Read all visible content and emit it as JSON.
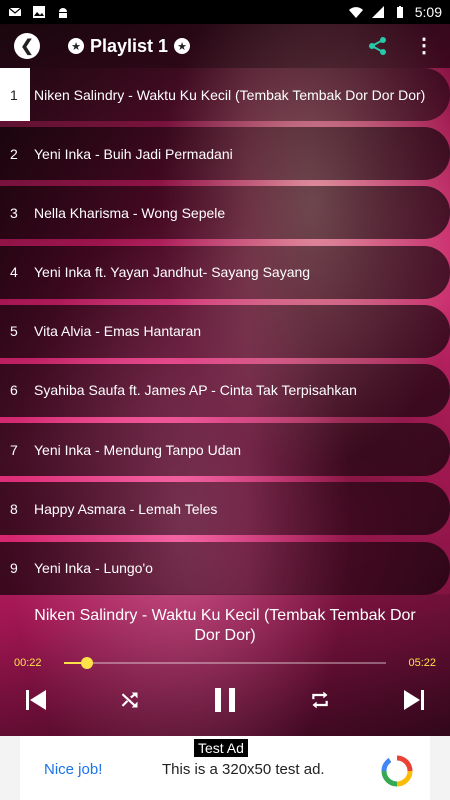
{
  "status_bar": {
    "time": "5:09",
    "left_icons": [
      "mail-icon",
      "image-icon",
      "android-icon"
    ],
    "right_icons": [
      "wifi-icon",
      "signal-icon",
      "battery-icon"
    ]
  },
  "appbar": {
    "title": "Playlist 1",
    "back_icon": "back-arrow-icon",
    "share_icon": "share-icon",
    "more_icon": "more-vertical-icon"
  },
  "playlist": {
    "active_index": 0,
    "tracks": [
      {
        "num": "1",
        "title": "Niken Salindry - Waktu Ku Kecil (Tembak Tembak Dor Dor Dor)"
      },
      {
        "num": "2",
        "title": "Yeni Inka - Buih Jadi Permadani"
      },
      {
        "num": "3",
        "title": "Nella Kharisma - Wong Sepele"
      },
      {
        "num": "4",
        "title": "Yeni Inka  ft. Yayan Jandhut- Sayang Sayang"
      },
      {
        "num": "5",
        "title": "Vita Alvia - Emas Hantaran"
      },
      {
        "num": "6",
        "title": "Syahiba Saufa ft. James AP - Cinta Tak Terpisahkan"
      },
      {
        "num": "7",
        "title": "Yeni Inka - Mendung Tanpo Udan"
      },
      {
        "num": "8",
        "title": "Happy Asmara - Lemah Teles"
      },
      {
        "num": "9",
        "title": "Yeni Inka - Lungo'o"
      }
    ]
  },
  "player": {
    "now_playing": "Niken Salindry - Waktu Ku Kecil (Tembak Tembak Dor Dor Dor)",
    "current_time": "00:22",
    "total_time": "05:22",
    "progress_fraction": 0.07,
    "accent_color": "#ffe24a",
    "controls": [
      "skip-previous-icon",
      "shuffle-icon",
      "pause-icon",
      "repeat-icon",
      "skip-next-icon"
    ]
  },
  "ad": {
    "badge": "Test Ad",
    "nice": "Nice job!",
    "text": "This is a 320x50 test ad."
  }
}
